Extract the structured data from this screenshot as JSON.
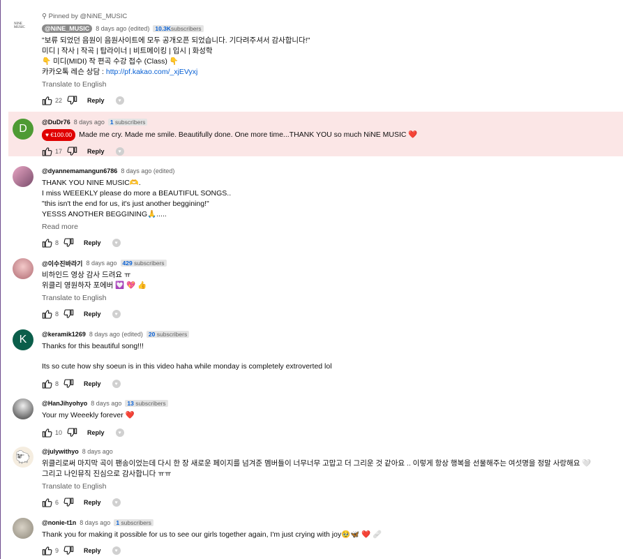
{
  "pinned_label": "Pinned by @NiNE_MUSIC",
  "reply_label": "Reply",
  "comments": [
    {
      "handle": "@NiNE_MUSIC",
      "time": "8 days ago (edited)",
      "subs_count": "10.3K",
      "subs_label": "subscribers",
      "lines": [
        "\"보류 되었던 음원이 음원사이트에 모두 공개오픈 되었습니다. 기다려주셔서 감사합니다!\"",
        "미디 | 작사 | 작곡 | 탑라이너 | 비트메이킹 | 입시 | 화성학",
        "👇 미디(MIDI) 작 편곡 수강 접수 (Class) 👇"
      ],
      "link_prefix": "카카오톡 레슨 상담 : ",
      "link": "http://pf.kakao.com/_xjEVyxj",
      "translate": "Translate to English",
      "likes": "22",
      "avatar_text": "NINE MUSIC"
    },
    {
      "handle": "@DuDr76",
      "time": "8 days ago",
      "subs_count": "1",
      "subs_label": "subscribers",
      "thanks_amount": "€100.00",
      "text": "Made me cry. Made me smile. Beautifully done. One more time...THANK YOU so much NiNE MUSIC ❤️",
      "likes": "17",
      "avatar_letter": "D",
      "avatar_color": "#4e9a34"
    },
    {
      "handle": "@dyannemamangun6786",
      "time": "8 days ago (edited)",
      "lines": [
        "THANK YOU NINE MUSIC🫶.",
        "I miss WEEEKLY please do more a BEAUTIFUL SONGS..",
        " \"this isn't the end for us, it's just another beggining!\"",
        "YESSS ANOTHER BEGGINING🙏....."
      ],
      "read_more": "Read more",
      "likes": "8"
    },
    {
      "handle": "@이수진바라기",
      "time": "8 days ago",
      "subs_count": "429",
      "subs_label": "subscribers",
      "lines": [
        "비하인드 영상 감사 드려요 ㅠ",
        "위클리 영원하자  포에버 💟 💖 👍"
      ],
      "translate": "Translate to English",
      "likes": "8"
    },
    {
      "handle": "@keramik1269",
      "time": "8 days ago (edited)",
      "subs_count": "20",
      "subs_label": "subscribers",
      "lines": [
        "Thanks for this beautiful song!!!",
        "",
        "Its so cute how shy soeun is in this video haha while monday is completely extroverted lol"
      ],
      "likes": "8",
      "avatar_letter": "K",
      "avatar_color": "#0b5e4a"
    },
    {
      "handle": "@HanJihyohyo",
      "time": "8 days ago",
      "subs_count": "13",
      "subs_label": "subscribers",
      "text": "Your my Weeekly forever ❤️",
      "likes": "10"
    },
    {
      "handle": "@julywithyo",
      "time": "8 days ago",
      "lines": [
        "위클리로써 마지막 곡이 팬송이었는데 다시 한 장 새로운 페이지를 넘겨준 멤버들이 너무너무 고맙고 더 그리운 것 같아요 .. 이렇게 항상 행복을 선물해주는 여섯명을 정말 사랑해요 🤍",
        "그리고 나인뮤직 진심으로 감사합니다 ㅠㅠ"
      ],
      "translate": "Translate to English",
      "likes": "6"
    },
    {
      "handle": "@nonie-t1n",
      "time": "8 days ago",
      "subs_count": "1",
      "subs_label": "subscribers",
      "text": "Thank you for making it possible for us to see our girls together again, I'm just crying with joy🥹🦋 ❤️ 🩹",
      "likes": "9"
    }
  ],
  "colors": {
    "link": "#065fd4",
    "highlight": "#fbe6e6",
    "thanks": "#e00000"
  }
}
